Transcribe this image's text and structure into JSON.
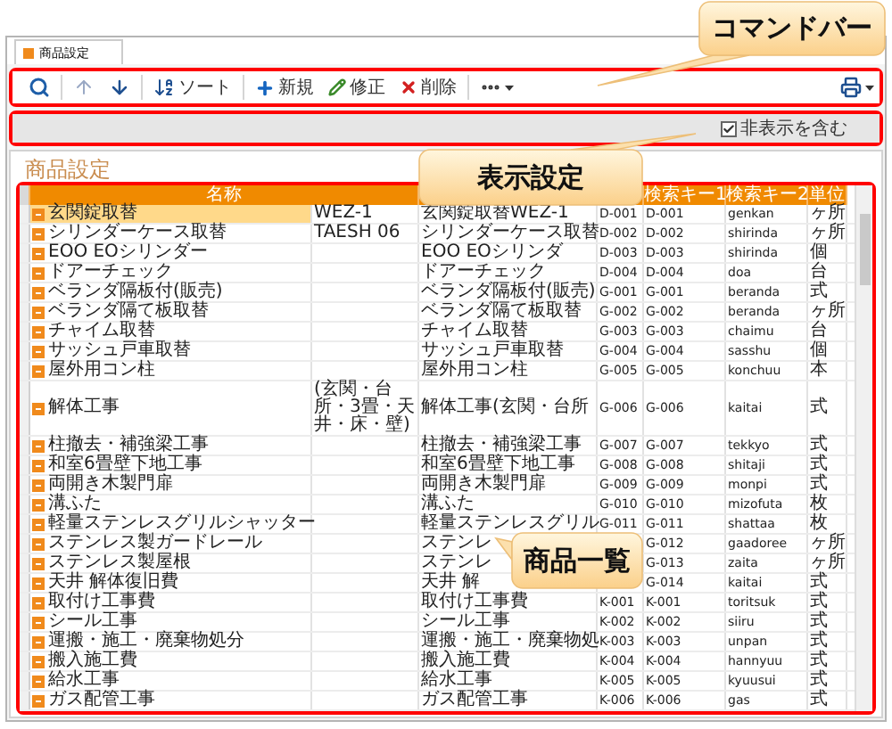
{
  "tab": {
    "label": "商品設定",
    "selected": true
  },
  "toolbar": {
    "groups": [
      [
        {
          "kind": "search"
        }
      ],
      [
        {
          "kind": "up"
        },
        {
          "kind": "down"
        }
      ],
      [
        {
          "kind": "sort",
          "label": "ソート"
        }
      ],
      [
        {
          "kind": "new",
          "label": "新規"
        },
        {
          "kind": "edit",
          "label": "修正"
        },
        {
          "kind": "delete",
          "label": "削除"
        }
      ],
      [
        {
          "kind": "more"
        }
      ]
    ]
  },
  "display_settings": {
    "include_hidden": {
      "label": "非表示を含む",
      "checked": true
    }
  },
  "page_title": "商品設定",
  "table": {
    "columns": [
      {
        "label": "名称",
        "kind": "double"
      },
      {
        "kind": "blank"
      },
      {
        "kind": "blank"
      },
      {
        "label": "検索キー1",
        "kind": "single"
      },
      {
        "label": "検索キー2",
        "kind": "single"
      },
      {
        "label": "単位",
        "kind": "single"
      }
    ],
    "rows": [
      {
        "selected": true,
        "name": "玄関錠取替",
        "spec": "WEZ-1",
        "column_3": "玄関錠取替WEZ-1",
        "column_4": "D-001",
        "search_key_1": "D-001",
        "search_key_2": "genkan",
        "unit": "ヶ所"
      },
      {
        "selected": false,
        "name": "シリンダーケース取替",
        "spec": "TAESH 06",
        "column_3": "シリンダーケース取替",
        "column_4": "D-002",
        "search_key_1": "D-002",
        "search_key_2": "shirinda",
        "unit": "ヶ所"
      },
      {
        "selected": false,
        "name": "EOO EOシリンダー",
        "column_3": "EOO EOシリンダ",
        "column_4": "D-003",
        "search_key_1": "D-003",
        "search_key_2": "shirinda",
        "unit": "個"
      },
      {
        "selected": false,
        "name": "ドアーチェック",
        "column_3": "ドアーチェック",
        "column_4": "D-004",
        "search_key_1": "D-004",
        "search_key_2": "doa",
        "unit": "台"
      },
      {
        "selected": false,
        "name": "ベランダ隔板付(販売)",
        "column_3": "ベランダ隔板付(販売)",
        "column_4": "G-001",
        "search_key_1": "G-001",
        "search_key_2": "beranda",
        "unit": "式"
      },
      {
        "selected": false,
        "name": "ベランダ隔て板取替",
        "column_3": "ベランダ隔て板取替",
        "column_4": "G-002",
        "search_key_1": "G-002",
        "search_key_2": "beranda",
        "unit": "ヶ所"
      },
      {
        "selected": false,
        "name": "チャイム取替",
        "column_3": "チャイム取替",
        "column_4": "G-003",
        "search_key_1": "G-003",
        "search_key_2": "chaimu",
        "unit": "台"
      },
      {
        "selected": false,
        "name": "サッシュ戸車取替",
        "column_3": "サッシュ戸車取替",
        "column_4": "G-004",
        "search_key_1": "G-004",
        "search_key_2": "sasshu",
        "unit": "個"
      },
      {
        "selected": false,
        "name": "屋外用コン柱",
        "column_3": "屋外用コン柱",
        "column_4": "G-005",
        "search_key_1": "G-005",
        "search_key_2": "konchuu",
        "unit": "本"
      },
      {
        "selected": false,
        "name": "解体工事",
        "spec": "(玄関・台所・3畳・天井・床・壁)",
        "column_3": "解体工事(玄関・台所",
        "column_4": "G-006",
        "search_key_1": "G-006",
        "search_key_2": "kaitai",
        "unit": "式"
      },
      {
        "selected": false,
        "name": "柱撤去・補強梁工事",
        "column_3": "柱撤去・補強梁工事",
        "column_4": "G-007",
        "search_key_1": "G-007",
        "search_key_2": "tekkyo",
        "unit": "式"
      },
      {
        "selected": false,
        "name": "和室6畳壁下地工事",
        "column_3": "和室6畳壁下地工事",
        "column_4": "G-008",
        "search_key_1": "G-008",
        "search_key_2": "shitaji",
        "unit": "式"
      },
      {
        "selected": false,
        "name": "両開き木製門扉",
        "column_3": "両開き木製門扉",
        "column_4": "G-009",
        "search_key_1": "G-009",
        "search_key_2": "monpi",
        "unit": "式"
      },
      {
        "selected": false,
        "name": "溝ふた",
        "column_3": "溝ふた",
        "column_4": "G-010",
        "search_key_1": "G-010",
        "search_key_2": "mizofuta",
        "unit": "枚"
      },
      {
        "selected": false,
        "name": "軽量ステンレスグリルシャッター",
        "column_3": "軽量ステンレスグリル",
        "column_4": "G-011",
        "search_key_1": "G-011",
        "search_key_2": "shattaa",
        "unit": "枚"
      },
      {
        "selected": false,
        "name": "ステンレス製ガードレール",
        "column_3": "ステンレ",
        "search_key_1": "G-012",
        "search_key_2": "gaadoree",
        "unit": "ヶ所"
      },
      {
        "selected": false,
        "name": "ステンレス製屋根",
        "column_3": "ステンレ",
        "search_key_1": "G-013",
        "search_key_2": "zaita",
        "unit": "ヶ所"
      },
      {
        "selected": false,
        "name": "天井 解体復旧費",
        "column_3": "天井 解",
        "search_key_1": "G-014",
        "search_key_2": "kaitai",
        "unit": "式"
      },
      {
        "selected": false,
        "name": "取付け工事費",
        "column_3": "取付け工事費",
        "column_4": "K-001",
        "search_key_1": "K-001",
        "search_key_2": "toritsuk",
        "unit": "式"
      },
      {
        "selected": false,
        "name": "シール工事",
        "column_3": "シール工事",
        "column_4": "K-002",
        "search_key_1": "K-002",
        "search_key_2": "siiru",
        "unit": "式"
      },
      {
        "selected": false,
        "name": "運搬・施工・廃棄物処分",
        "column_3": "運搬・施工・廃棄物処",
        "column_4": "K-003",
        "search_key_1": "K-003",
        "search_key_2": "unpan",
        "unit": "式"
      },
      {
        "selected": false,
        "name": "搬入施工費",
        "column_3": "搬入施工費",
        "column_4": "K-004",
        "search_key_1": "K-004",
        "search_key_2": "hannyuu",
        "unit": "式"
      },
      {
        "selected": false,
        "name": "給水工事",
        "column_3": "給水工事",
        "column_4": "K-005",
        "search_key_1": "K-005",
        "search_key_2": "kyuusui",
        "unit": "式"
      },
      {
        "selected": false,
        "name": "ガス配管工事",
        "column_3": "ガス配管工事",
        "column_4": "K-006",
        "search_key_1": "K-006",
        "search_key_2": "gas",
        "unit": "式"
      }
    ]
  },
  "callouts": [
    {
      "text": "コマンドバー"
    },
    {
      "text": "表示設定"
    },
    {
      "text": "商品一覧"
    }
  ]
}
